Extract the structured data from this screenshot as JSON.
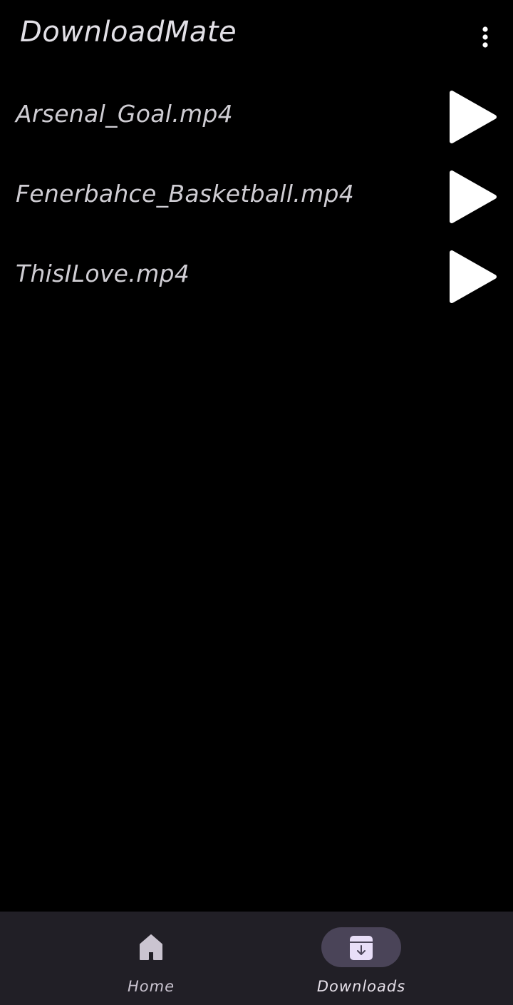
{
  "app_bar": {
    "title": "DownloadMate",
    "menu_icon": "more-vert-icon"
  },
  "files": [
    {
      "name": "Arsenal_Goal.mp4",
      "action_icon": "play-icon"
    },
    {
      "name": "Fenerbahce_Basketball.mp4",
      "action_icon": "play-icon"
    },
    {
      "name": "ThisILove.mp4",
      "action_icon": "play-icon"
    }
  ],
  "bottom_nav": {
    "items": [
      {
        "label": "Home",
        "icon": "home-icon",
        "selected": false
      },
      {
        "label": "Downloads",
        "icon": "download-box-icon",
        "selected": true
      }
    ]
  },
  "colors": {
    "background": "#000000",
    "title_text": "#e2e0e6",
    "file_text": "#cfcdd3",
    "play_icon": "#ffffff",
    "nav_background": "#211f26",
    "nav_active_indicator": "#4a4458",
    "nav_icon": "#cac4d0",
    "nav_active_icon": "#e8def8"
  }
}
